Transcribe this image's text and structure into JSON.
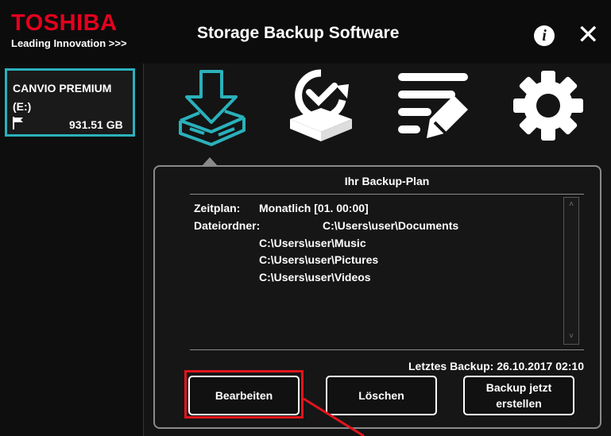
{
  "brand": {
    "name": "TOSHIBA",
    "tagline": "Leading Innovation >>>"
  },
  "window": {
    "title": "Storage Backup Software"
  },
  "titlebar_icons": {
    "info": "i",
    "close": "✕"
  },
  "sidebar": {
    "drive": {
      "name": "CANVIO PREMIUM",
      "letter": "(E:)",
      "size": "931.51 GB",
      "icon": "flag-icon"
    }
  },
  "toolbar": {
    "items": [
      {
        "icon": "backup-download-icon",
        "active": true
      },
      {
        "icon": "restore-icon",
        "active": false
      },
      {
        "icon": "list-edit-icon",
        "active": false
      },
      {
        "icon": "settings-gear-icon",
        "active": false
      }
    ]
  },
  "panel": {
    "title": "Ihr Backup-Plan",
    "schedule_label": "Zeitplan:",
    "schedule_value": "Monatlich [01. 00:00]",
    "folders_label": "Dateiordner:",
    "folders": [
      "C:\\Users\\user\\Documents",
      "C:\\Users\\user\\Music",
      "C:\\Users\\user\\Pictures",
      "C:\\Users\\user\\Videos"
    ],
    "last_backup": "Letztes Backup: 26.10.2017 02:10"
  },
  "buttons": {
    "edit": "Bearbeiten",
    "delete": "Löschen",
    "backup_now_line1": "Backup jetzt",
    "backup_now_line2": "erstellen"
  },
  "colors": {
    "accent": "#2ab1bb",
    "brand": "#e4001e",
    "highlight": "#e1141c"
  }
}
